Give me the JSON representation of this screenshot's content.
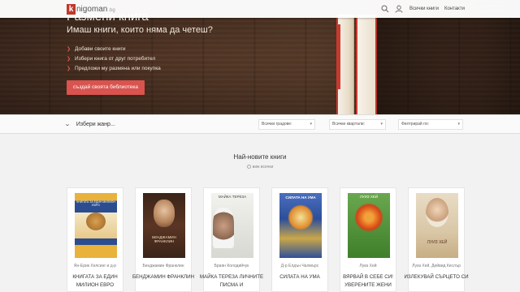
{
  "nav": {
    "logo_letter": "k",
    "logo_name": "nigoman",
    "logo_tld": ".bg",
    "search_icon": "search-icon",
    "user_icon": "user-icon",
    "links": [
      "Всички книги",
      "Контакти"
    ]
  },
  "hero": {
    "title": "Размени книга",
    "subtitle": "Имаш книги, които няма да четеш?",
    "bullets": [
      "Добави своите книги",
      "Избери книга от друг потребител",
      "Предложи му размяна или покупка"
    ],
    "cta": "създай своята библиотека",
    "accent": "#d9534f"
  },
  "filters": {
    "genre": "Избери жанр...",
    "cities": "Всички градове:",
    "cities_value": "",
    "quarters": "Всички квартали:",
    "quarters_value": "",
    "filter_by": "Филтрирай по:",
    "filter_by_value": ""
  },
  "newest": {
    "title": "Най-новите книги",
    "view_all": "виж всички",
    "books": [
      {
        "author": "Ян-Ерик Хелсинг и д-р",
        "title": "КНИГАТА ЗА ЕДИН МИЛИОН ЕВРО",
        "cover_text": "КНИГАТА ЗА ЕДИН МИЛИОН ЕВРО"
      },
      {
        "author": "Бенджамин Франклин",
        "title": "БЕНДЖАМИН ФРАНКЛИН",
        "cover_text": "БЕНДЖАМИН ФРАНКЛИН"
      },
      {
        "author": "Браян Колодийчук",
        "title": "МАЙКА ТЕРЕЗА ЛИЧНИТЕ ПИСМА И",
        "cover_text": "МАЙКА ТЕРЕЗА"
      },
      {
        "author": "Д-р Елдън Чалмърс",
        "title": "СИЛАТА НА УМА",
        "cover_text": "СИЛАТА НА УМА"
      },
      {
        "author": "Луиз Хей",
        "title": "ВЯРВАЙ В СЕБЕ СИ! УВЕРЕНИТЕ ЖЕНИ",
        "cover_text": "ЛУИЗ ХЕЙ"
      },
      {
        "author": "Луиз Хей, Дейвид Кеслър",
        "title": "ИЗЛЕКУВАЙ СЪРЦЕТО СИ",
        "cover_text": "ЛУИЗ ХЕЙ"
      }
    ]
  }
}
